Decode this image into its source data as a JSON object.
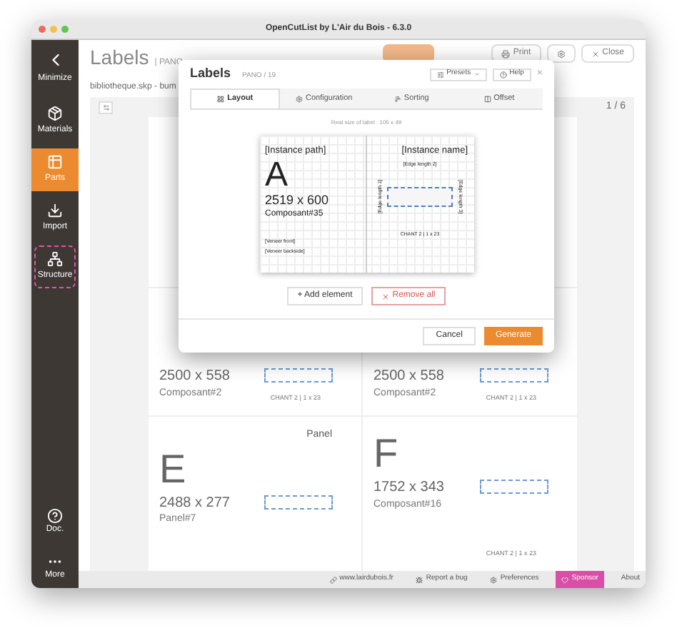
{
  "window": {
    "title": "OpenCutList by L'Air du Bois - 6.3.0"
  },
  "sidebar": {
    "items": [
      {
        "label": "Minimize",
        "kind": "minimize",
        "selected": false
      },
      {
        "label": "Materials",
        "kind": "materials",
        "selected": false
      },
      {
        "label": "Parts",
        "kind": "parts",
        "selected": true
      },
      {
        "label": "Import",
        "kind": "import",
        "selected": false
      },
      {
        "label": "Structure",
        "kind": "structure",
        "selected": false
      }
    ],
    "bottom": [
      {
        "label": "Doc.",
        "kind": "doc"
      },
      {
        "label": "More",
        "kind": "more"
      }
    ]
  },
  "header": {
    "title": "Labels",
    "subtitle": "| PANO",
    "buttons": [
      {
        "label": "Print",
        "kind": "print"
      },
      {
        "kind": "settings"
      },
      {
        "label": "Close",
        "kind": "close"
      }
    ]
  },
  "breadcrumb": "bibliotheque.skp - bum",
  "pager": "1 / 6",
  "sheet": {
    "rows": [
      [
        {},
        {}
      ],
      [
        {
          "dims": "2500 x 558",
          "name": "Composant#2",
          "edge": "CHANT 2 | 1 x 23"
        },
        {
          "dims": "2500 x 558",
          "name": "Composant#2",
          "edge": "CHANT 2 | 1 x 23"
        }
      ],
      [
        {
          "top": "Panel",
          "letter": "E",
          "dims": "2488 x 277",
          "name": "Panel#7"
        },
        {
          "letter": "F",
          "dims": "1752 x 343",
          "name": "Composant#16",
          "edge": "CHANT 2 | 1 x 23"
        }
      ]
    ]
  },
  "dialog": {
    "title": "Labels",
    "subtitle": "PANO / 19",
    "presets": "Presets",
    "help": "Help",
    "close": "×",
    "tabs": [
      {
        "label": "Layout",
        "kind": "layout",
        "selected": true
      },
      {
        "label": "Configuration",
        "kind": "config",
        "selected": false
      },
      {
        "label": "Sorting",
        "kind": "sorting",
        "selected": false
      },
      {
        "label": "Offset",
        "kind": "offset",
        "selected": false
      }
    ],
    "real_size": "Real size of label : 105 x 49",
    "preview": {
      "path": "[Instance path]",
      "iname": "[Instance name]",
      "edge2": "[Edge length 2]",
      "letter": "A",
      "dims": "2519 x 600",
      "name": "Composant#35",
      "edge1": "[Edge length 1]",
      "edge3": "[Edge length 3]",
      "veneer_front": "[Veneer front]",
      "veneer_back": "[Veneer backside]",
      "edge": "CHANT 2 | 1 x 23"
    },
    "add": "+ Add element",
    "remove": "Remove all",
    "cancel": "Cancel",
    "generate": "Generate"
  },
  "footer": [
    {
      "label": "www.lairdubois.fr",
      "kind": "link"
    },
    {
      "label": "Report a bug",
      "kind": "bug"
    },
    {
      "label": "Preferences",
      "kind": "prefs"
    },
    {
      "label": "Sponsor",
      "kind": "sponsor"
    },
    {
      "label": "About",
      "kind": "about"
    }
  ]
}
